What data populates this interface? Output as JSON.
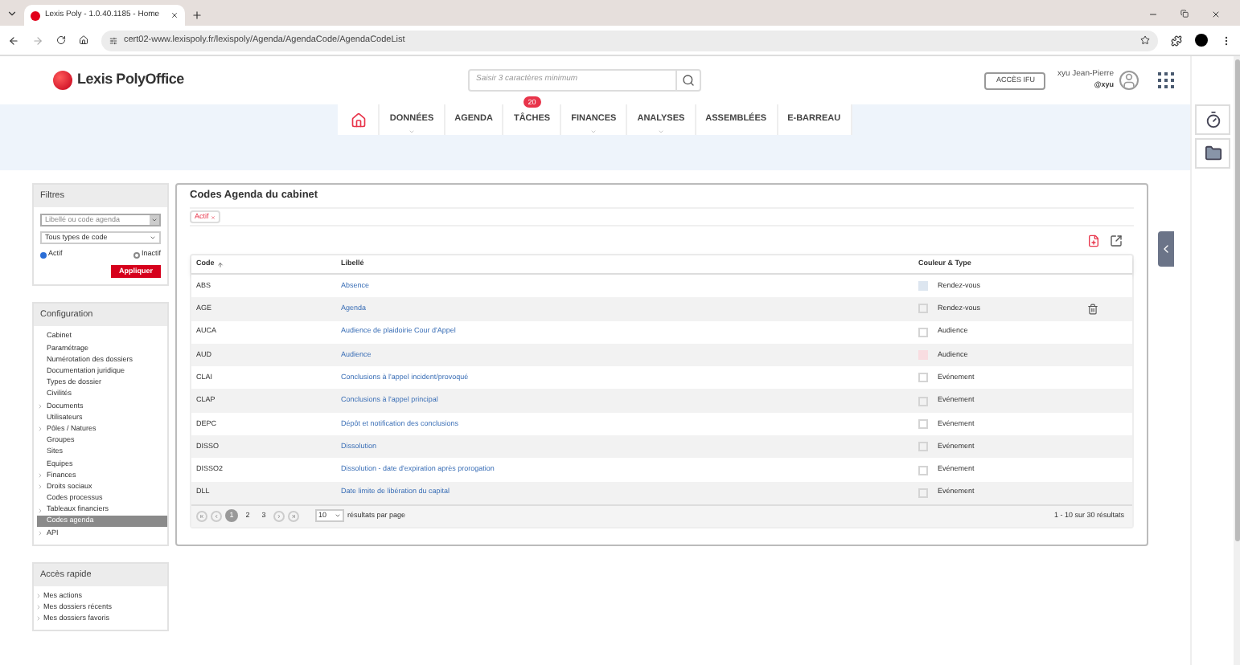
{
  "browser": {
    "tab_title": "Lexis Poly - 1.0.40.1185 - Home",
    "url": "cert02-www.lexispoly.fr/lexispoly/Agenda/AgendaCode/AgendaCodeList"
  },
  "header": {
    "logo": "Lexis PolyOffice",
    "search_placeholder": "Saisir 3 caractères minimum",
    "ifu_button": "ACCÈS IFU",
    "user_name": "xyu Jean-Pierre",
    "user_handle": "@xyu"
  },
  "nav": [
    {
      "kind": "home",
      "has_menu": false
    },
    {
      "kind": "text",
      "label": "DONNÉES",
      "has_menu": true
    },
    {
      "kind": "text",
      "label": "AGENDA",
      "has_menu": false
    },
    {
      "kind": "text",
      "label": "TÂCHES",
      "has_menu": false,
      "badge": "20"
    },
    {
      "kind": "text",
      "label": "FINANCES",
      "has_menu": true
    },
    {
      "kind": "text",
      "label": "ANALYSES",
      "has_menu": true
    },
    {
      "kind": "text",
      "label": "ASSEMBLÉES",
      "has_menu": false
    },
    {
      "kind": "text",
      "label": "E-BARREAU",
      "has_menu": false
    }
  ],
  "filters": {
    "title": "Filtres",
    "search_placeholder": "Libellé ou code agenda",
    "type_select": "Tous types de code",
    "radios": [
      {
        "label": "Actif",
        "selected": true
      },
      {
        "label": "Inactif",
        "selected": false
      }
    ],
    "apply": "Appliquer"
  },
  "configuration": {
    "title": "Configuration",
    "items": [
      {
        "label": "Cabinet",
        "expandable": false,
        "selected": false
      },
      {
        "label": "Paramétrage",
        "expandable": false,
        "selected": false
      },
      {
        "label": "Numérotation des dossiers",
        "expandable": false,
        "selected": false
      },
      {
        "label": "Documentation juridique",
        "expandable": false,
        "selected": false
      },
      {
        "label": "Types de dossier",
        "expandable": false,
        "selected": false
      },
      {
        "label": "Civilités",
        "expandable": false,
        "selected": false
      },
      {
        "label": "Documents",
        "expandable": true,
        "selected": false
      },
      {
        "label": "Utilisateurs",
        "expandable": false,
        "selected": false
      },
      {
        "label": "Pôles / Natures",
        "expandable": true,
        "selected": false
      },
      {
        "label": "Groupes",
        "expandable": false,
        "selected": false
      },
      {
        "label": "Sites",
        "expandable": false,
        "selected": false
      },
      {
        "label": "Equipes",
        "expandable": false,
        "selected": false
      },
      {
        "label": "Finances",
        "expandable": true,
        "selected": false
      },
      {
        "label": "Droits sociaux",
        "expandable": true,
        "selected": false
      },
      {
        "label": "Codes processus",
        "expandable": false,
        "selected": false
      },
      {
        "label": "Tableaux financiers",
        "expandable": true,
        "selected": false
      },
      {
        "label": "Codes agenda",
        "expandable": false,
        "selected": true
      },
      {
        "label": "API",
        "expandable": true,
        "selected": false
      }
    ]
  },
  "quick_access": {
    "title": "Accès rapide",
    "items": [
      "Mes actions",
      "Mes dossiers récents",
      "Mes dossiers favoris"
    ]
  },
  "card": {
    "title": "Codes Agenda du cabinet",
    "tag": "Actif",
    "columns": [
      "Code",
      "Libellé",
      "Couleur & Type"
    ],
    "rows": [
      {
        "code": "ABS",
        "label": "Absence",
        "color": "#dde6f0",
        "type": "Rendez-vous",
        "hovered": false
      },
      {
        "code": "AGE",
        "label": "Agenda",
        "type": "Rendez-vous",
        "hovered": true
      },
      {
        "code": "AUCA",
        "label": "Audience de plaidoirie Cour d'Appel",
        "type": "Audience",
        "hovered": false
      },
      {
        "code": "AUD",
        "label": "Audience",
        "color": "#f9dde1",
        "type": "Audience",
        "hovered": false
      },
      {
        "code": "CLAI",
        "label": "Conclusions à l'appel incident/provoqué",
        "type": "Evénement",
        "hovered": false
      },
      {
        "code": "CLAP",
        "label": "Conclusions à l'appel principal",
        "type": "Evénement",
        "hovered": false
      },
      {
        "code": "DEPC",
        "label": "Dépôt et notification des conclusions",
        "type": "Evénement",
        "hovered": false
      },
      {
        "code": "DISSO",
        "label": "Dissolution",
        "type": "Evénement",
        "hovered": false
      },
      {
        "code": "DISSO2",
        "label": "Dissolution - date d'expiration après prorogation",
        "type": "Evénement",
        "hovered": false
      },
      {
        "code": "DLL",
        "label": "Date limite de libération du capital",
        "type": "Evénement",
        "hovered": false
      }
    ],
    "pages": [
      {
        "label": "1",
        "selected": true
      },
      {
        "label": "2",
        "selected": false
      },
      {
        "label": "3",
        "selected": false
      }
    ],
    "per_page": "10",
    "per_page_label": "résultats par page",
    "summary": "1 - 10 sur 30 résultats"
  }
}
